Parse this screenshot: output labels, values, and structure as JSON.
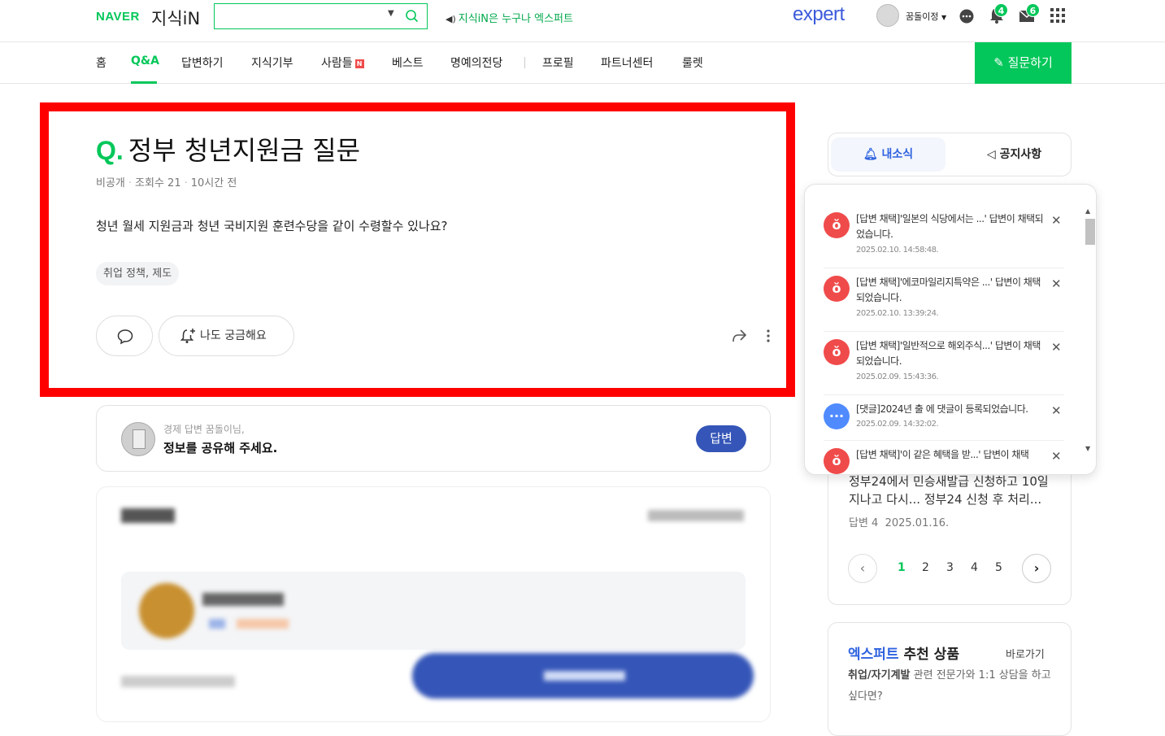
{
  "header": {
    "logo_naver": "NAVER",
    "logo_service": "지식iN",
    "search_value": "",
    "promo": "지식iN은 누구나 엑스퍼트",
    "expert_logo": "expert",
    "username": "꿈돌이정",
    "notif_count": "4",
    "mail_count": "6"
  },
  "nav": {
    "items": [
      "홈",
      "Q&A",
      "답변하기",
      "지식기부",
      "사람들",
      "베스트",
      "명예의전당",
      "프로필",
      "파트너센터",
      "룰렛"
    ],
    "active": "Q&A",
    "new_mark": "N",
    "ask_button": "질문하기"
  },
  "question": {
    "q_mark": "Q.",
    "title": "정부 청년지원금 질문",
    "meta_visibility": "비공개",
    "meta_views": "조회수 21",
    "meta_time": "10시간 전",
    "body": "청년 월세 지원금과 청년 국비지원 훈련수당을 같이 수령할수 있나요?",
    "tag": "취업 정책, 제도",
    "curious_label": "나도 궁금해요"
  },
  "answer_prompt": {
    "sub": "경제 답변 꿈돌이님,",
    "main": "정보를 공유해 주세요.",
    "button": "답변"
  },
  "side_tabs": {
    "mynews": "내소식",
    "notice": "공지사항"
  },
  "notifications": [
    {
      "type": "select",
      "text": "[답변 채택]'일본의 식당에서는 ...' 답변이 채택되었습니다.",
      "time": "2025.02.10. 14:58:48."
    },
    {
      "type": "select",
      "text": "[답변 채택]'에코마일리지특약은 ...' 답변이 채택되었습니다.",
      "time": "2025.02.10. 13:39:24."
    },
    {
      "type": "select",
      "text": "[답변 채택]'일반적으로 해외주식...' 답변이 채택되었습니다.",
      "time": "2025.02.09. 15:43:36."
    },
    {
      "type": "comment",
      "text": "[댓글]2024년 출 에 댓글이 등록되었습니다.",
      "time": "2025.02.09. 14:32:02."
    },
    {
      "type": "select",
      "text": "[답변 채택]'이 같은 혜택을 받...' 답변이 채택",
      "time": ""
    }
  ],
  "side_list": {
    "text": "정부24에서 민승새발급 신청하고 10일 지나고 다시... 정부24 신청 후 처리...",
    "answers": "답변 4",
    "date": "2025.01.16.",
    "pages": [
      "1",
      "2",
      "3",
      "4",
      "5"
    ],
    "active_page": "1"
  },
  "expert_card": {
    "title_blue": "엑스퍼트",
    "title_rest": "추천 상품",
    "link": "바로가기",
    "desc_bold": "취업/자기계발",
    "desc_rest": "관련 전문가와 1:1 상담을 하고 싶다면?"
  },
  "colors": {
    "brand_green": "#03c75a",
    "highlight_red": "#ff0000",
    "answer_blue": "#3556b8",
    "notif_red": "#f04b4b",
    "comment_blue": "#4f8bff"
  }
}
